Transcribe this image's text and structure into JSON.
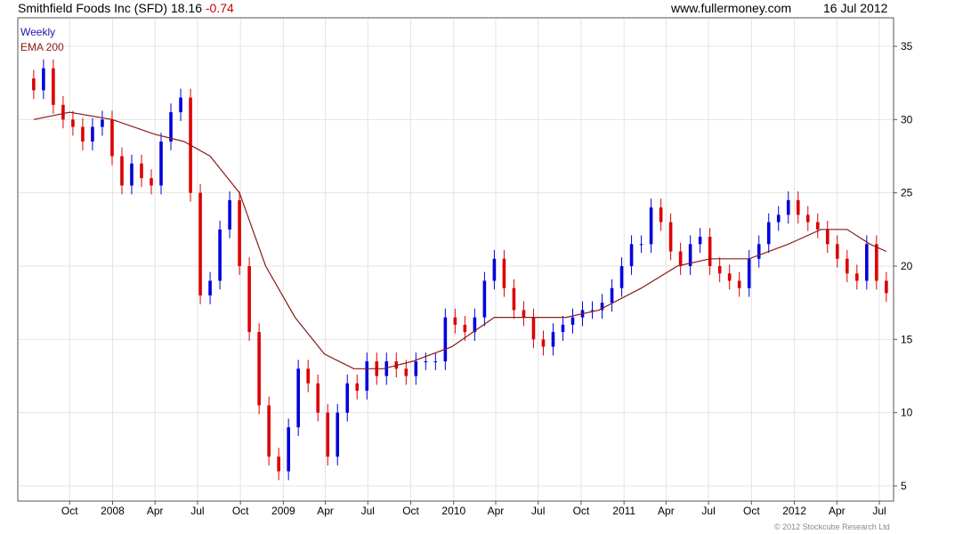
{
  "header": {
    "title": "Smithfield Foods Inc (SFD)",
    "last": "18.16",
    "change": "-0.74",
    "site": "www.fullermoney.com",
    "date": "16 Jul 2012"
  },
  "legend": [
    {
      "label": "Weekly",
      "color": "#1a1aa6"
    },
    {
      "label": "EMA 200",
      "color": "#8b1a1a"
    }
  ],
  "copyright": "© 2012 Stockcube Research Ltd",
  "colors": {
    "up": "#0000dd",
    "down": "#dd0000",
    "ema": "#8b1a1a",
    "grid": "#e4e4e4"
  },
  "chart_data": {
    "type": "line",
    "frequency": "weekly",
    "ylim": [
      5,
      36
    ],
    "y_ticks": [
      5,
      10,
      15,
      20,
      25,
      30,
      35
    ],
    "x_ticks": [
      "Oct",
      "2008",
      "Apr",
      "Jul",
      "Oct",
      "2009",
      "Apr",
      "Jul",
      "Oct",
      "2010",
      "Apr",
      "Jul",
      "Oct",
      "2011",
      "Apr",
      "Jul",
      "Oct",
      "2012",
      "Apr",
      "Jul"
    ],
    "grid": true,
    "legend_position": "top-left",
    "series": [
      {
        "name": "Weekly",
        "style": "candlestick",
        "x": [
          "2007-07-16",
          "2007-08-06",
          "2007-08-27",
          "2007-09-17",
          "2007-10-08",
          "2007-10-29",
          "2007-11-19",
          "2007-12-10",
          "2007-12-31",
          "2008-01-21",
          "2008-02-11",
          "2008-03-03",
          "2008-03-24",
          "2008-04-14",
          "2008-05-05",
          "2008-05-26",
          "2008-06-16",
          "2008-07-07",
          "2008-07-28",
          "2008-08-18",
          "2008-09-08",
          "2008-09-29",
          "2008-10-20",
          "2008-11-10",
          "2008-12-01",
          "2008-12-22",
          "2009-01-12",
          "2009-02-02",
          "2009-02-23",
          "2009-03-16",
          "2009-04-06",
          "2009-04-27",
          "2009-05-18",
          "2009-06-08",
          "2009-06-29",
          "2009-07-20",
          "2009-08-10",
          "2009-08-31",
          "2009-09-21",
          "2009-10-12",
          "2009-11-02",
          "2009-11-23",
          "2009-12-14",
          "2010-01-04",
          "2010-01-25",
          "2010-02-15",
          "2010-03-08",
          "2010-03-29",
          "2010-04-19",
          "2010-05-10",
          "2010-05-31",
          "2010-06-21",
          "2010-07-12",
          "2010-08-02",
          "2010-08-23",
          "2010-09-13",
          "2010-10-04",
          "2010-10-25",
          "2010-11-15",
          "2010-12-06",
          "2010-12-27",
          "2011-01-17",
          "2011-02-07",
          "2011-02-28",
          "2011-03-21",
          "2011-04-11",
          "2011-05-02",
          "2011-05-23",
          "2011-06-13",
          "2011-07-04",
          "2011-07-25",
          "2011-08-15",
          "2011-09-05",
          "2011-09-26",
          "2011-10-17",
          "2011-11-07",
          "2011-11-28",
          "2011-12-19",
          "2012-01-09",
          "2012-01-30",
          "2012-02-20",
          "2012-03-12",
          "2012-04-02",
          "2012-04-23",
          "2012-05-14",
          "2012-06-04",
          "2012-06-25",
          "2012-07-16"
        ],
        "close": [
          32,
          33.5,
          31,
          30,
          29.5,
          28.5,
          29.5,
          30,
          27.5,
          25.5,
          27,
          26,
          25.5,
          28.5,
          30.5,
          31.5,
          25,
          18,
          19,
          22.5,
          24.5,
          20,
          15.5,
          10.5,
          7,
          6,
          9,
          13,
          12,
          10,
          7,
          10,
          12,
          11.5,
          13.5,
          12.5,
          13.5,
          13,
          12.5,
          13.5,
          13.5,
          13.5,
          16.5,
          16,
          15.5,
          16.5,
          19,
          20.5,
          18.5,
          17,
          16.5,
          15,
          14.5,
          15.5,
          16,
          16.5,
          17,
          17,
          17.5,
          18.5,
          20,
          21.5,
          21.5,
          24,
          23,
          21,
          20,
          21.5,
          22,
          20,
          19.5,
          19,
          18.5,
          20.5,
          21.5,
          23,
          23.5,
          24.5,
          23.5,
          23,
          22.5,
          21.5,
          20.5,
          19.5,
          19,
          21.5,
          19,
          18.16
        ]
      },
      {
        "name": "EMA 200",
        "x": [
          "2007-07-16",
          "2007-10-01",
          "2007-12-31",
          "2008-03-31",
          "2008-06-02",
          "2008-07-28",
          "2008-09-29",
          "2008-11-24",
          "2009-01-26",
          "2009-03-30",
          "2009-06-01",
          "2009-08-03",
          "2009-10-05",
          "2009-12-28",
          "2010-03-29",
          "2010-06-07",
          "2010-08-30",
          "2010-11-08",
          "2011-02-07",
          "2011-04-25",
          "2011-07-04",
          "2011-09-26",
          "2011-12-19",
          "2012-02-27",
          "2012-04-23",
          "2012-06-11",
          "2012-07-16"
        ],
        "values": [
          30,
          30.5,
          30,
          29,
          28.5,
          27.5,
          25,
          20,
          16.5,
          14,
          13,
          13,
          13.5,
          14.5,
          16.5,
          16.5,
          16.5,
          17,
          18.5,
          20,
          20.5,
          20.5,
          21.5,
          22.5,
          22.5,
          21.5,
          21
        ]
      }
    ]
  }
}
